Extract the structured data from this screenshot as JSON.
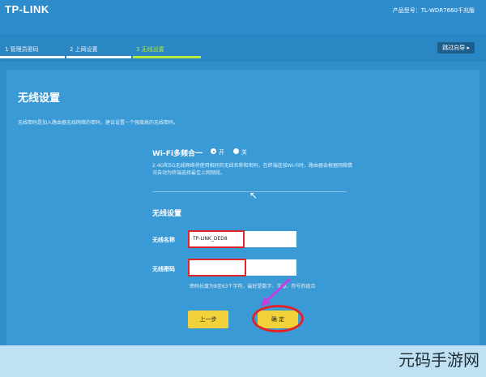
{
  "header": {
    "logo": "TP-LINK",
    "model": "产品型号：TL-WDR7660千兆版"
  },
  "steps": [
    {
      "label": "1 管理员密码"
    },
    {
      "label": "2 上网设置"
    },
    {
      "label": "3 无线设置",
      "active": true
    }
  ],
  "guide_button": "跳过向导 ▸",
  "panel": {
    "title": "无线设置",
    "desc": "无线密码是加入路由器无线网络的密码，建议设置一个强度高的无线密码。",
    "mlo": {
      "label": "Wi-Fi多频合一",
      "on_label": "开",
      "off_label": "关",
      "selected": "开",
      "desc": "2.4G和5G无线网络将使用相同的无线名称和密码，在终端连接Wi-Fi时，路由器会根据网络情况自动为终端选择最佳上网频段。"
    },
    "wireless": {
      "title": "无线设置",
      "name_label": "无线名称",
      "name_value": "TP-LINK_DED8",
      "pwd_label": "无线密码",
      "pwd_value": "",
      "hint": "密码长度为8至63个字符，最好是数字、字母、符号的组合"
    },
    "prev_button": "上一步",
    "ok_button": "确 定"
  },
  "watermark": "元码手游网",
  "colors": {
    "accent": "#b7ea3a",
    "button": "#f2d23a",
    "highlight": "#e0242c",
    "arrow": "#c43ee0"
  }
}
